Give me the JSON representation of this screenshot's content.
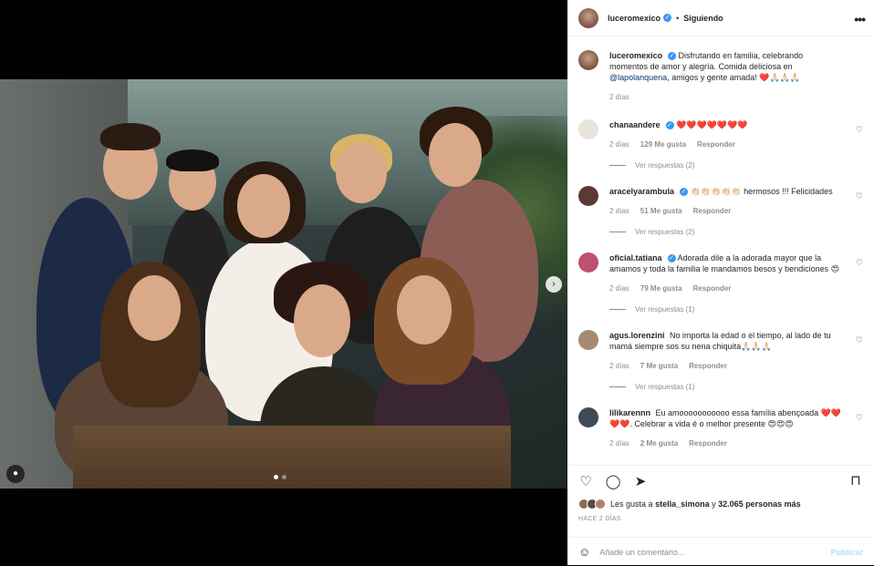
{
  "post": {
    "username": "luceromexico",
    "follow_status": "Siguiendo",
    "separator": "•",
    "caption": "Disfrutando en familia, celebrando momentos de amor y alegría. Comida deliciosa en",
    "caption_mention": "@lapolanquena",
    "caption_end": ", amigos y gente amada! ❤️🙏🏻🙏🏻🙏🏻",
    "caption_time": "2 días"
  },
  "comments": [
    {
      "username": "chanaandere",
      "verified": true,
      "text": "❤️❤️❤️❤️❤️❤️❤️",
      "time": "2 días",
      "likes": "129 Me gusta",
      "reply": "Responder",
      "replies": "Ver respuestas (2)",
      "avatar_color": "#e8e4da"
    },
    {
      "username": "aracelyarambula",
      "verified": true,
      "text": "👏🏻👏🏻👏🏻👏🏻👏🏻 hermosos !!! Felicidades",
      "time": "2 días",
      "likes": "51 Me gusta",
      "reply": "Responder",
      "replies": "Ver respuestas (2)",
      "avatar_color": "#5a3a33"
    },
    {
      "username": "oficial.tatiana",
      "verified": true,
      "text": "Adorada dile a la adorada mayor que la amamos y toda la familia le mandamos besos y bendiciones 😍",
      "time": "2 días",
      "likes": "79 Me gusta",
      "reply": "Responder",
      "replies": "Ver respuestas (1)",
      "avatar_color": "#c05070"
    },
    {
      "username": "agus.lorenzini",
      "verified": false,
      "text": "No importa la edad o el tiempo, al lado de tu mamá siempre sos su nena chiquita🙏🏻🙏🏻🙏🏻",
      "time": "2 días",
      "likes": "7 Me gusta",
      "reply": "Responder",
      "replies": "Ver respuestas (1)",
      "avatar_color": "#a48a72"
    },
    {
      "username": "lilikarennn",
      "verified": false,
      "text": "Eu amooooooooooo essa família abençoada ❤️❤️❤️❤️. Celebrar a vida é o melhor presente 😍😍😍",
      "time": "2 días",
      "likes": "2 Me gusta",
      "reply": "Responder",
      "replies": "",
      "avatar_color": "#3e4a55"
    }
  ],
  "likes": {
    "prefix": "Les gusta a",
    "user": "stella_simona",
    "middle": "y",
    "count": "32.065 personas más"
  },
  "time_ago": "HACE 2 DÍAS",
  "add_comment": {
    "placeholder": "Añade un comentario...",
    "publish": "Publicar"
  },
  "icons": {
    "more": "more-dots-icon",
    "like": "heart-icon",
    "comment": "comment-icon",
    "share": "share-icon",
    "save": "bookmark-icon",
    "emoji": "emoji-icon",
    "next": "chevron-right-icon",
    "tag": "user-tag-icon"
  },
  "colors": {
    "verified": "#3897f0",
    "publish_disabled": "#b2dffc",
    "mention": "#00376b",
    "muted": "#8e8e8e"
  },
  "carousel": {
    "total": 2,
    "active": 1
  }
}
